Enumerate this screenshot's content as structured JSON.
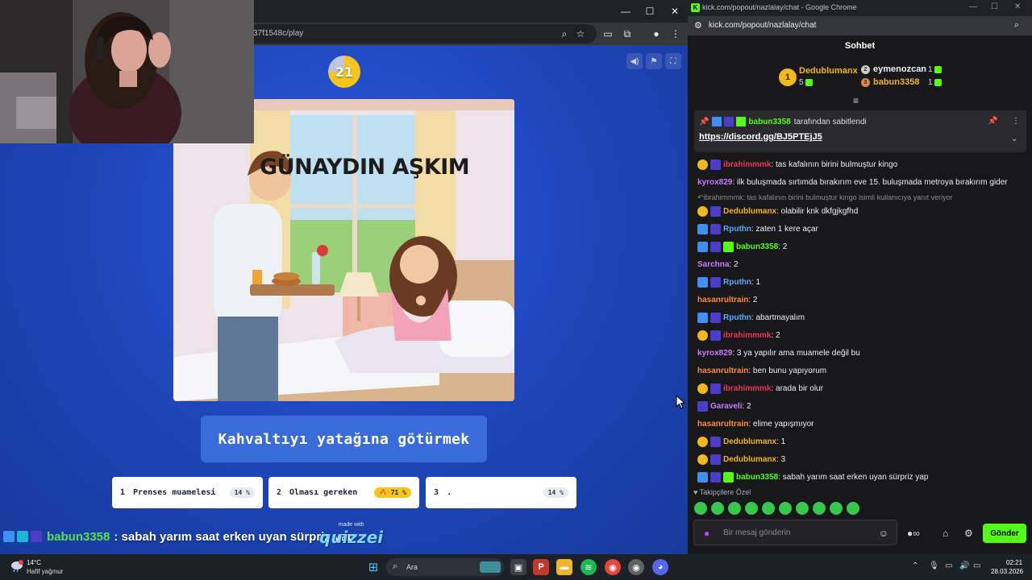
{
  "game": {
    "address_url": "37f1548c/play",
    "timer": "21",
    "caption": "GÜNAYDIN AŞKIM",
    "answer": "Kahvaltıyı yatağına götürmek",
    "options": [
      {
        "num": "1",
        "label": "Prenses muamelesi",
        "pct": "14 %"
      },
      {
        "num": "2",
        "label": "Olması gereken",
        "pct": "🔥 71 %"
      },
      {
        "num": "3",
        "label": ".",
        "pct": "14 %"
      }
    ],
    "overlay_user": "babun3358",
    "overlay_text": ": sabah yarım saat erken uyan sürpriz yap",
    "made_with": "made with",
    "brand": "quizzei"
  },
  "chat_window": {
    "title": "kick.com/popout/nazlalay/chat - Google Chrome",
    "url": "kick.com/popout/nazlalay/chat",
    "header": "Sohbet",
    "leaderboard": {
      "first": {
        "name": "Dedublumanx",
        "count": "5",
        "rank": "1"
      },
      "second": {
        "name": "eymenozcan",
        "count": "1",
        "rank": "2"
      },
      "third": {
        "name": "babun3358",
        "count": "1",
        "rank": "3"
      }
    },
    "pinned": {
      "user": "babun3358",
      "suffix": "tarafından sabitlendi",
      "link": "https://discord.gg/BJ5PTEjJ5"
    },
    "messages": [
      {
        "badges": [
          "coin",
          "star"
        ],
        "user": "ibrahimmmk",
        "color": "#e9365a",
        "text": ": tas kafalının birini bulmuştur kingo"
      },
      {
        "badges": [],
        "user": "kyrox829",
        "color": "#c77dff",
        "text": ": ilk buluşmada sırtımda bırakırım eve 15. buluşmada metroya bırakırım gider"
      },
      {
        "reply": "ibrahimmmk: tas kafalının birini bulmuştur kingo isimli kullanıcıya yanıt veriyor"
      },
      {
        "badges": [
          "coin",
          "star"
        ],
        "user": "Dedublumanx",
        "color": "#f2b41f",
        "text": ": olabilir knk dkfgjkgfhd"
      },
      {
        "badges": [
          "blue",
          "star"
        ],
        "user": "Rputhn",
        "color": "#5aa9ff",
        "text": ": zaten 1 kere açar"
      },
      {
        "badges": [
          "blue",
          "star",
          "green"
        ],
        "user": "babun3358",
        "color": "#53fc18",
        "text": ": 2"
      },
      {
        "badges": [],
        "user": "Sarchna",
        "color": "#c77dff",
        "text": ": 2"
      },
      {
        "badges": [
          "blue",
          "star"
        ],
        "user": "Rputhn",
        "color": "#5aa9ff",
        "text": ": 1"
      },
      {
        "badges": [],
        "user": "hasanrultrain",
        "color": "#ff8a3d",
        "text": ": 2"
      },
      {
        "badges": [
          "blue",
          "star"
        ],
        "user": "Rputhn",
        "color": "#5aa9ff",
        "text": ": abartmayalım"
      },
      {
        "badges": [
          "coin",
          "star"
        ],
        "user": "ibrahimmmk",
        "color": "#e9365a",
        "text": ": 2"
      },
      {
        "badges": [],
        "user": "kyrox829",
        "color": "#c77dff",
        "text": ": 3 ya yapılır ama muamele değil bu"
      },
      {
        "badges": [],
        "user": "hasanrultrain",
        "color": "#ff8a3d",
        "text": ": ben bunu yapıyorum"
      },
      {
        "badges": [
          "coin",
          "star"
        ],
        "user": "ibrahimmmk",
        "color": "#e9365a",
        "text": ": arada bir olur"
      },
      {
        "badges": [
          "star"
        ],
        "user": "Garaveli",
        "color": "#c77dff",
        "text": ": 2"
      },
      {
        "badges": [],
        "user": "hasanrultrain",
        "color": "#ff8a3d",
        "text": ": elime yapışmıyor"
      },
      {
        "badges": [
          "coin",
          "star"
        ],
        "user": "Dedublumanx",
        "color": "#f2b41f",
        "text": ": 1"
      },
      {
        "badges": [
          "coin",
          "star"
        ],
        "user": "Dedublumanx",
        "color": "#f2b41f",
        "text": ": 3"
      },
      {
        "badges": [
          "blue",
          "star",
          "green"
        ],
        "user": "babun3358",
        "color": "#53fc18",
        "text": ": sabah yarım saat erken uyan sürpriz yap"
      }
    ],
    "follower_note": "Takipçilere Özel",
    "input_placeholder": "Bir mesaj gönderin",
    "send_label": "Gönder"
  },
  "taskbar": {
    "temperature": "14°C",
    "weather": "Hafif yağmur",
    "search": "Ara",
    "time": "02:21",
    "date": "28.03.2026"
  },
  "colors": {
    "kick_green": "#53fc18",
    "game_blue": "#1d45b8",
    "timer_yellow": "#f7c51b"
  }
}
